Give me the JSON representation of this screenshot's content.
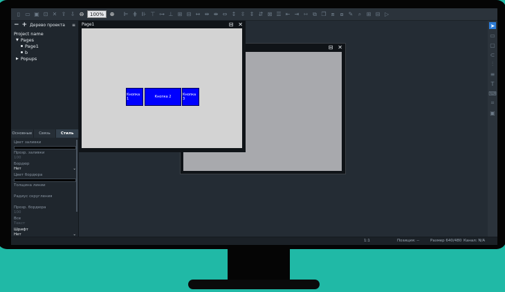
{
  "toolbar": {
    "zoom_value": "100%"
  },
  "left_panel": {
    "title": "Дерево проекта",
    "tree": {
      "project": "Project name",
      "pages": "Pages",
      "page1": "Page1",
      "item_b": "b",
      "popups": "Popups"
    },
    "tabs": [
      "Основные",
      "Связь",
      "Стиль"
    ],
    "props": {
      "fill_color_label": "Цвет заливки",
      "fill_opacity_label": "Прозр. заливки",
      "fill_opacity_value": "100",
      "border_label": "Бордюр",
      "border_value": "Нет",
      "border_color_label": "Цвет бордюра",
      "border_width_label": "Толщина линии",
      "corner_radius_label": "Радиус скругления",
      "border_opacity_label": "Прозр. бордюра",
      "border_opacity_value": "100",
      "font_label": "Все",
      "font_value": "Текст",
      "shadow_label": "Шрифт",
      "shadow_value": "Нет"
    }
  },
  "canvas": {
    "page_window_title": "Page1",
    "buttons": [
      "Кнопка 1",
      "Кнопка 2",
      "Кнопка 3"
    ]
  },
  "status": {
    "scale": "1:1",
    "position": "Позиция: --",
    "size": "Размер 640/480",
    "channel": "Канал: N/A"
  },
  "colors": {
    "accent": "#2d7cd6",
    "button_fill": "#0000ff",
    "background": "#20b9a6"
  }
}
